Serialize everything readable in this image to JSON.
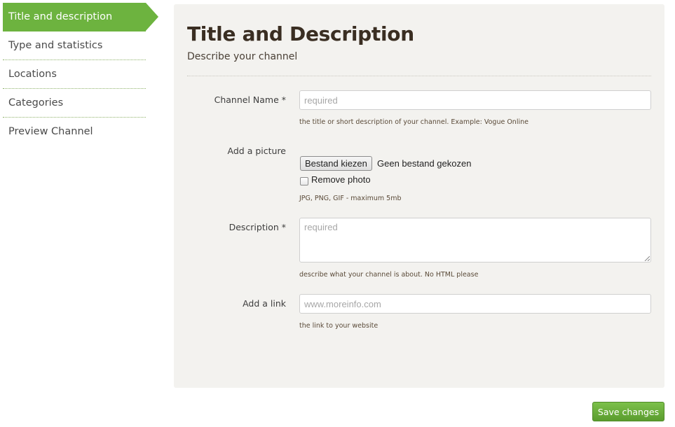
{
  "sidebar": {
    "items": [
      {
        "label": "Title and description",
        "active": true
      },
      {
        "label": "Type and statistics",
        "active": false
      },
      {
        "label": "Locations",
        "active": false
      },
      {
        "label": "Categories",
        "active": false
      },
      {
        "label": "Preview Channel",
        "active": false
      }
    ]
  },
  "main": {
    "title": "Title and Description",
    "subtitle": "Describe your channel",
    "channel_name": {
      "label": "Channel Name *",
      "value": "",
      "placeholder": "required",
      "help": "the title or short description of your channel. Example: Vogue Online"
    },
    "picture": {
      "label": "Add a picture",
      "choose_button": "Bestand kiezen",
      "file_status": "Geen bestand gekozen",
      "remove_label": "Remove photo",
      "remove_checked": false,
      "help": "JPG, PNG, GIF - maximum 5mb"
    },
    "description": {
      "label": "Description *",
      "value": "",
      "placeholder": "required",
      "help": "describe what your channel is about. No HTML please"
    },
    "link": {
      "label": "Add a link",
      "value": "",
      "placeholder": "www.moreinfo.com",
      "help": "the link to your website"
    }
  },
  "actions": {
    "save_label": "Save changes"
  },
  "colors": {
    "accent": "#6db33f",
    "panel_bg": "#f3f2ef",
    "title": "#3a2e22"
  }
}
